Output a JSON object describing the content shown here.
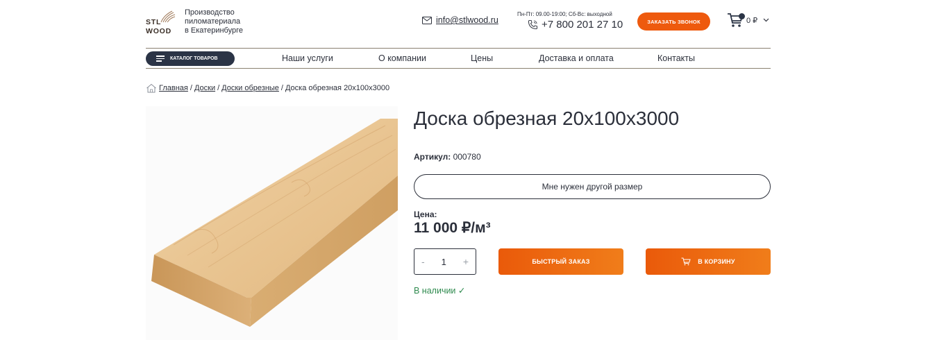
{
  "header": {
    "logo_line1": "STL",
    "logo_line2": "WOOD",
    "tagline": [
      "Производство",
      "пиломатериала",
      "в Екатеринбурге"
    ],
    "email": "info@stlwood.ru",
    "hours": "Пн-Пт: 09.00-19:00; Сб-Вс: выходной",
    "phone": "+7 800 201 27 10",
    "call_button": "ЗАКАЗАТЬ ЗВОНОК",
    "cart_total": "0 ₽",
    "icons": {
      "email": "envelope-icon",
      "phone": "phone-icon",
      "cart": "cart-icon",
      "cart_dropdown": "chevron-down-icon"
    }
  },
  "nav": {
    "catalog_button": "КАТАЛОГ ТОВАРОВ",
    "items": [
      "Наши услуги",
      "О компании",
      "Цены",
      "Доставка и оплата",
      "Контакты"
    ]
  },
  "breadcrumb": {
    "items": [
      "Главная",
      "Доски",
      "Доски обрезные"
    ],
    "current": "Доска обрезная 20х100х3000",
    "separator": "/"
  },
  "product": {
    "title": "Доска обрезная 20х100х3000",
    "sku_label": "Артикул:",
    "sku_value": "000780",
    "size_button": "Мне нужен другой размер",
    "price_label": "Цена:",
    "price": "11 000 ₽/м³",
    "quantity": "1",
    "minus": "-",
    "plus": "+",
    "quick_order_button": "БЫСТРЫЙ ЗАКАЗ",
    "add_to_cart_button": "В КОРЗИНУ",
    "stock": "В наличии ✓"
  },
  "colors": {
    "accent": "#ee5a0e",
    "dark": "#2b3446",
    "text": "#2b2f3a",
    "in_stock": "#2e8a4e"
  }
}
